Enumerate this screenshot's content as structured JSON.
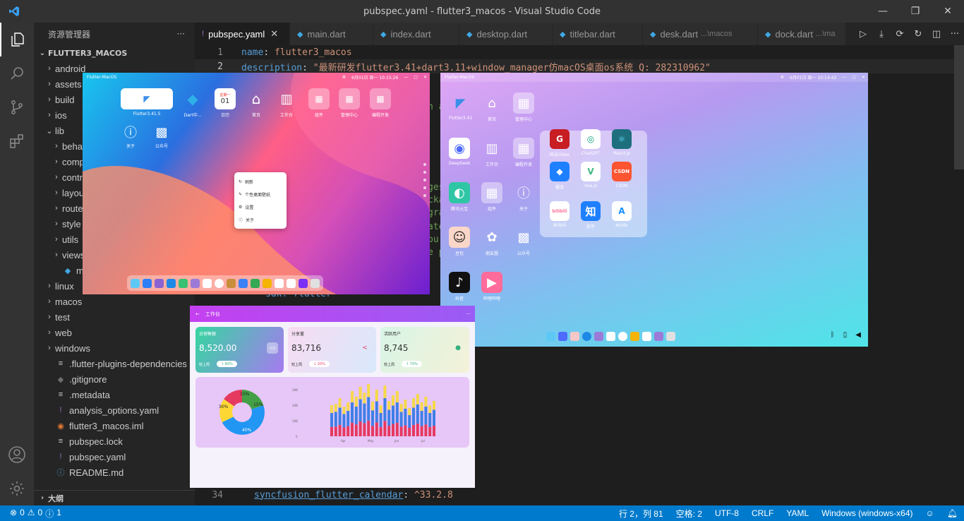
{
  "window": {
    "title": "pubspec.yaml - flutter3_macos - Visual Studio Code"
  },
  "sidebar": {
    "header": "资源管理器",
    "more": "···",
    "project": "FLUTTER3_MACOS",
    "items": [
      {
        "label": "android",
        "type": "folder"
      },
      {
        "label": "assets",
        "type": "folder"
      },
      {
        "label": "build",
        "type": "folder"
      },
      {
        "label": "ios",
        "type": "folder"
      },
      {
        "label": "lib",
        "type": "folder-open"
      },
      {
        "label": "behav",
        "type": "folder"
      },
      {
        "label": "comp",
        "type": "folder"
      },
      {
        "label": "contr",
        "type": "folder"
      },
      {
        "label": "layou",
        "type": "folder"
      },
      {
        "label": "route",
        "type": "folder"
      },
      {
        "label": "style",
        "type": "folder"
      },
      {
        "label": "utils",
        "type": "folder"
      },
      {
        "label": "views",
        "type": "folder"
      },
      {
        "label": "main",
        "type": "dart"
      },
      {
        "label": "linux",
        "type": "folder"
      },
      {
        "label": "macos",
        "type": "folder"
      },
      {
        "label": "test",
        "type": "folder"
      },
      {
        "label": "web",
        "type": "folder"
      },
      {
        "label": "windows",
        "type": "folder"
      },
      {
        "label": ".flutter-plugins-dependencies",
        "type": "file"
      },
      {
        "label": ".gitignore",
        "type": "git"
      },
      {
        "label": ".metadata",
        "type": "file"
      },
      {
        "label": "analysis_options.yaml",
        "type": "yaml"
      },
      {
        "label": "flutter3_macos.iml",
        "type": "rss"
      },
      {
        "label": "pubspec.lock",
        "type": "file"
      },
      {
        "label": "pubspec.yaml",
        "type": "yaml"
      },
      {
        "label": "README.md",
        "type": "info"
      }
    ],
    "outline": "大纲"
  },
  "tabs": [
    {
      "label": "pubspec.yaml",
      "icon": "!",
      "active": true,
      "desc": ""
    },
    {
      "label": "main.dart",
      "icon": "◆",
      "active": false,
      "desc": ""
    },
    {
      "label": "index.dart",
      "icon": "◆",
      "active": false,
      "desc": ""
    },
    {
      "label": "desktop.dart",
      "icon": "◆",
      "active": false,
      "desc": ""
    },
    {
      "label": "titlebar.dart",
      "icon": "◆",
      "active": false,
      "desc": ""
    },
    {
      "label": "desk.dart",
      "icon": "◆",
      "active": false,
      "desc": "...\\macos"
    },
    {
      "label": "dock.dart",
      "icon": "◆",
      "active": false,
      "desc": "...\\ma"
    }
  ],
  "editor": {
    "line1_no": "1",
    "line1_key": "name",
    "line1_val": "flutter3_macos",
    "line2_no": "2",
    "line2_key": "description",
    "line2_val": "\"最新研发flutter3.41+dart3.11+window_manager仿macOS桌面os系统  Q: 282310962\"",
    "line34_no": "34",
    "line34_key": "syncfusion_flutter_calendar",
    "line34_val": "^33.2.8",
    "frag_a": "n a",
    "frag_b": "ges",
    "frag_c": "cka",
    "frag_d": "gra",
    "frag_e": "ate",
    "frag_f": "bu",
    "frag_g": "e pu",
    "frag_sdk": "sdk: flutter"
  },
  "status": {
    "errors": "0",
    "warnings": "0",
    "info": "1",
    "position": "行 2，列 81",
    "spaces": "空格: 2",
    "encoding": "UTF-8",
    "eol": "CRLF",
    "language": "YAML",
    "platform": "Windows (windows-x64)"
  },
  "shot1": {
    "title": "Flutter-MacOS",
    "clock": "6月01日 周一 10:15:26",
    "icons": [
      "Flutter3.41.5",
      "Dart中...",
      "日历",
      "首页",
      "工作台",
      "组件",
      "管理中心",
      "编程开发",
      "关于",
      "公众号"
    ],
    "cal_day": "星期一",
    "cal_num": "01",
    "menu": [
      "刷新",
      "个性桌面壁纸",
      "设置",
      "关于"
    ]
  },
  "shot2": {
    "title": "Flutter-MacOS",
    "clock": "6月01日 周一 10:14:42",
    "icons": [
      "Flutter3.41",
      "首页",
      "管理中心",
      "DeepSeek",
      "工作台",
      "编程开发",
      "腾讯元宝",
      "组件",
      "关于",
      "豆包",
      "朋友圈",
      "公众号",
      "抖音",
      "哔哩哔哩"
    ],
    "folder": [
      "码云Gitee",
      "ChatGPT",
      "React.js",
      "掘金",
      "Vue.js",
      "CSDN",
      "Bilibili",
      "知乎",
      "Antdv"
    ],
    "csdn": "CSDN",
    "zhihu": "知",
    "bili": "bilibili"
  },
  "shot3": {
    "title": "工作台",
    "cards": [
      {
        "label": "日销售额",
        "value": "8,520.00",
        "sub": "较上周",
        "pill": "↑ 80%",
        "icon": "▭"
      },
      {
        "label": "分享量",
        "value": "83,716",
        "sub": "较上周",
        "pill": "↓ 20%",
        "icon": "<"
      },
      {
        "label": "活跃用户",
        "value": "8,745",
        "sub": "较上周",
        "pill": "↑ 70%",
        "icon": "●"
      }
    ],
    "pie": [
      "15%",
      "15%",
      "30%",
      "40%"
    ],
    "yticks": [
      "30B",
      "20B",
      "10B",
      "0"
    ],
    "xticks": [
      "Apr",
      "May",
      "Jun",
      "Jul"
    ]
  },
  "colors": {
    "statusbar": "#007acc",
    "accent": "#569cd6",
    "string": "#ce9178"
  }
}
